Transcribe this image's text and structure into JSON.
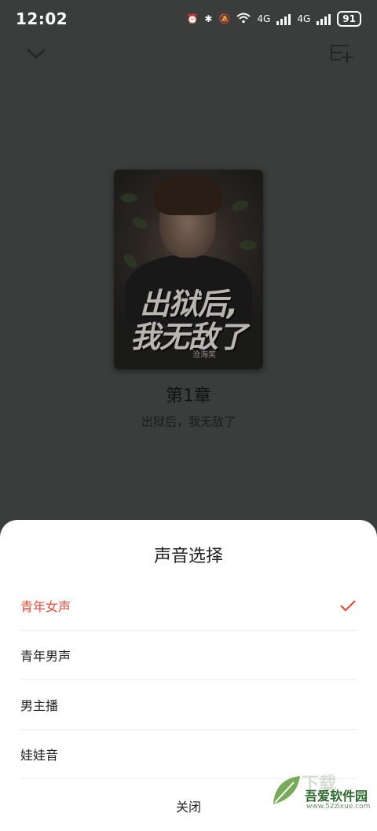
{
  "status_bar": {
    "time": "12:02",
    "network_1": "4G",
    "network_2": "4G",
    "battery": "91"
  },
  "top_bar": {
    "collapse_icon": "chevron-down-icon",
    "add_to_list_icon": "playlist-add-icon"
  },
  "book": {
    "cover_title_line1": "出狱后,",
    "cover_title_line2": "我无敌了",
    "cover_author": "沧海笑",
    "chapter": "第1章",
    "title": "出狱后，我无敌了"
  },
  "voice_sheet": {
    "title": "声音选择",
    "options": [
      {
        "label": "青年女声",
        "selected": true
      },
      {
        "label": "青年男声",
        "selected": false
      },
      {
        "label": "男主播",
        "selected": false
      },
      {
        "label": "娃娃音",
        "selected": false
      }
    ],
    "close_label": "关闭"
  },
  "watermark": {
    "brand": "吾爱软件园",
    "url": "www.52zixue.com",
    "bg_text": "下载"
  },
  "colors": {
    "accent": "#e04b3b",
    "overlay": "#3b3c3c",
    "sheet": "#ffffff"
  }
}
